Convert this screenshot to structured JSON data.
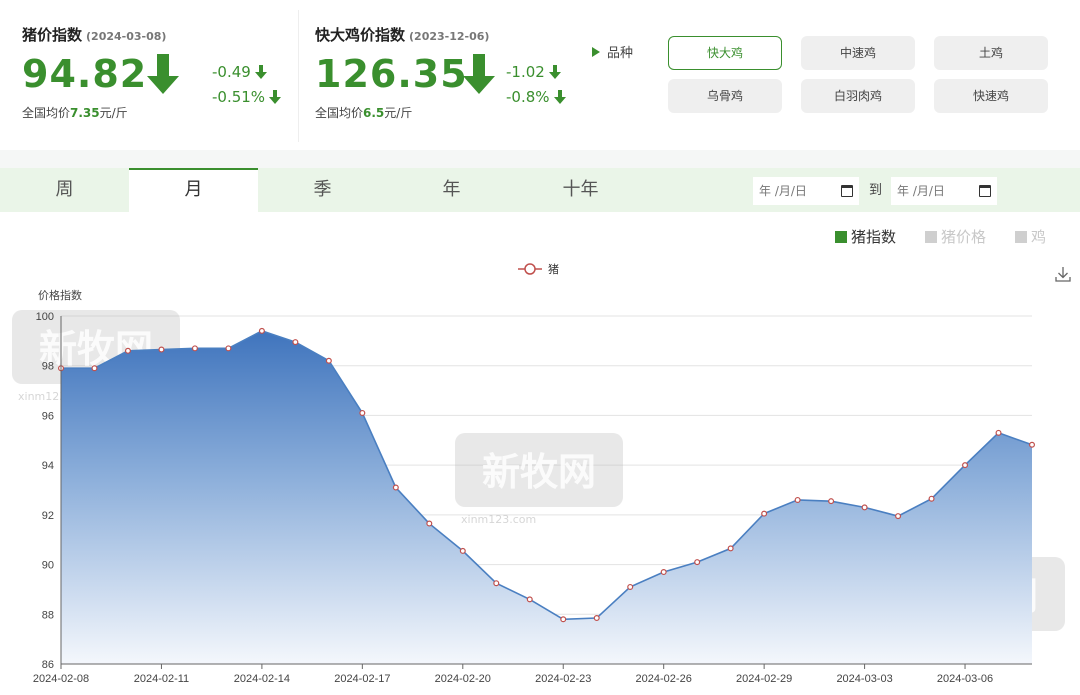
{
  "pig_index": {
    "title": "猪价指数",
    "date": "(2024-03-08)",
    "value": "94.82",
    "change_abs": "-0.49",
    "change_pct": "-0.51%",
    "avg_prefix": "全国均价",
    "avg_value": "7.35",
    "avg_unit": "元/斤",
    "trend_icon": "arrow-down-icon"
  },
  "chicken_index": {
    "title": "快大鸡价指数",
    "date": "(2023-12-06)",
    "value": "126.35",
    "change_abs": "-1.02",
    "change_pct": "-0.8%",
    "avg_prefix": "全国均价",
    "avg_value": "6.5",
    "avg_unit": "元/斤",
    "trend_icon": "arrow-down-icon"
  },
  "breeds": {
    "label": "品种",
    "items": [
      "快大鸡",
      "中速鸡",
      "土鸡",
      "乌骨鸡",
      "白羽肉鸡",
      "快速鸡"
    ],
    "selected": "快大鸡"
  },
  "period_tabs": {
    "items": [
      "周",
      "月",
      "季",
      "年",
      "十年"
    ],
    "active": "月"
  },
  "date_range": {
    "start_placeholder": "年 /月/日",
    "end_placeholder": "年 /月/日",
    "separator": "到"
  },
  "filters": [
    {
      "label": "猪指数",
      "active": true
    },
    {
      "label": "猪价格",
      "active": false
    },
    {
      "label": "鸡",
      "active": false
    }
  ],
  "colors": {
    "accent_green": "#3a8f2e",
    "line_blue": "#4a7fc1",
    "marker_red": "#c0504d"
  },
  "chart_data": {
    "type": "area",
    "ylabel": "价格指数",
    "ylim": [
      86,
      100
    ],
    "yticks": [
      86,
      88,
      90,
      92,
      94,
      96,
      98,
      100
    ],
    "grid": true,
    "legend_position": "top-center",
    "x_tick_labels": [
      "2024-02-08",
      "2024-02-11",
      "2024-02-14",
      "2024-02-17",
      "2024-02-20",
      "2024-02-23",
      "2024-02-26",
      "2024-02-29",
      "2024-03-03",
      "2024-03-06"
    ],
    "x": [
      "2024-02-08",
      "2024-02-09",
      "2024-02-10",
      "2024-02-11",
      "2024-02-12",
      "2024-02-13",
      "2024-02-14",
      "2024-02-15",
      "2024-02-16",
      "2024-02-17",
      "2024-02-18",
      "2024-02-19",
      "2024-02-20",
      "2024-02-21",
      "2024-02-22",
      "2024-02-23",
      "2024-02-24",
      "2024-02-25",
      "2024-02-26",
      "2024-02-27",
      "2024-02-28",
      "2024-02-29",
      "2024-03-01",
      "2024-03-02",
      "2024-03-03",
      "2024-03-04",
      "2024-03-05",
      "2024-03-06",
      "2024-03-07",
      "2024-03-08"
    ],
    "series": [
      {
        "name": "猪",
        "values": [
          97.9,
          97.9,
          98.6,
          98.65,
          98.7,
          98.7,
          99.4,
          98.95,
          98.2,
          96.1,
          93.1,
          91.65,
          90.55,
          89.25,
          88.6,
          87.8,
          87.85,
          89.1,
          89.7,
          90.1,
          90.65,
          92.05,
          92.6,
          92.55,
          92.3,
          91.95,
          92.65,
          94.0,
          95.3,
          94.82
        ]
      }
    ]
  },
  "watermark": {
    "text": "新牧网",
    "url_text": "xinm123.com"
  }
}
